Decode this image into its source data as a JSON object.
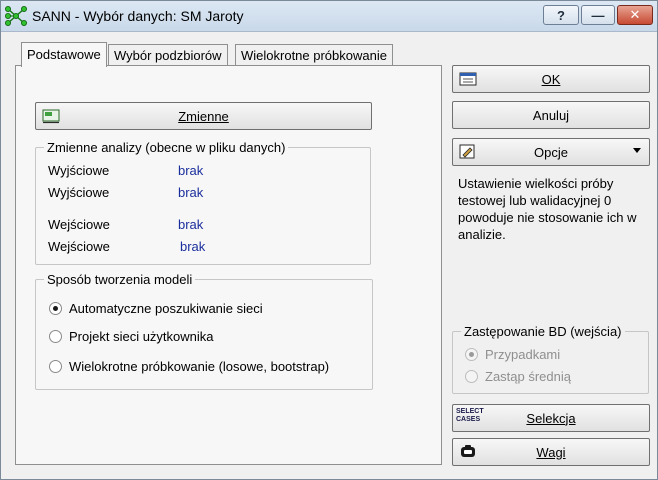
{
  "window": {
    "title": "SANN - Wybór danych: SM Jaroty",
    "help_label": "?",
    "minimize_label": "—",
    "close_label": "✕"
  },
  "tabs": [
    {
      "label": "Podstawowe",
      "active": true
    },
    {
      "label": "Wybór podzbiorów",
      "active": false
    },
    {
      "label": "Wielokrotne próbkowanie",
      "active": false
    }
  ],
  "main": {
    "variables_button": "Zmienne",
    "analysis_group": {
      "title": "Zmienne analizy (obecne w pliku danych)",
      "rows": [
        {
          "label": "Wyjściowe",
          "value": "brak"
        },
        {
          "label": "Wyjściowe",
          "value": "brak"
        },
        {
          "label": "Wejściowe",
          "value": "brak"
        },
        {
          "label": "Wejściowe",
          "value": "brak"
        }
      ]
    },
    "model_group": {
      "title": "Sposób tworzenia modeli",
      "options": [
        {
          "label": "Automatyczne poszukiwanie sieci",
          "checked": true
        },
        {
          "label": "Projekt sieci użytkownika",
          "checked": false
        },
        {
          "label": "Wielokrotne próbkowanie (losowe, bootstrap)",
          "checked": false
        }
      ]
    }
  },
  "side": {
    "ok_label": "OK",
    "cancel_label": "Anuluj",
    "options_label": "Opcje",
    "info_text": "Ustawienie wielkości próby testowej lub walidacyjnej 0 powoduje nie stosowanie ich w analizie.",
    "md_group": {
      "title": "Zastępowanie BD (wejścia)",
      "options": [
        {
          "label": "Przypadkami",
          "checked": true
        },
        {
          "label": "Zastąp średnią",
          "checked": false
        }
      ]
    },
    "select_icon_text": "SELECT CASES",
    "selection_label": "Selekcja",
    "weights_label": "Wagi"
  }
}
